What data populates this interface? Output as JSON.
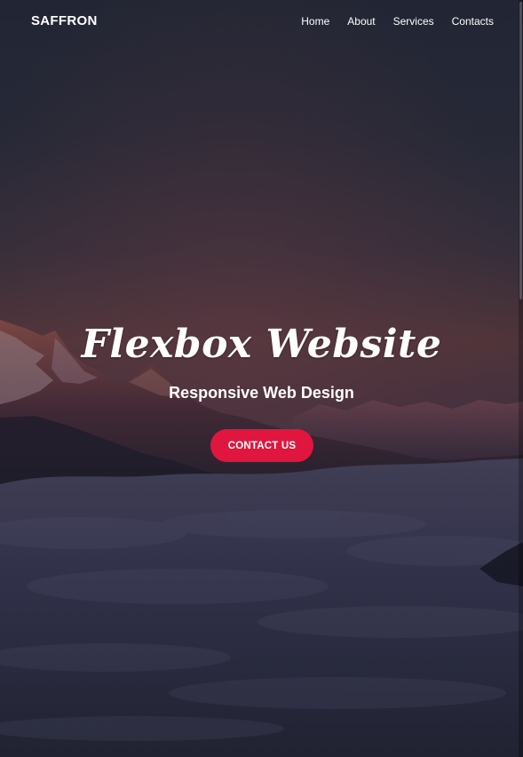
{
  "brand": {
    "name": "SAFFRON"
  },
  "nav": {
    "links": [
      {
        "label": "Home"
      },
      {
        "label": "About"
      },
      {
        "label": "Services"
      },
      {
        "label": "Contacts"
      }
    ]
  },
  "hero": {
    "title": "Flexbox Website",
    "subtitle": "Responsive Web Design",
    "cta_label": "CONTACT US",
    "background": "mountain-clouds-sunset"
  },
  "colors": {
    "accent": "#e0163f",
    "text": "#ffffff",
    "sky_top": "#2b3040",
    "sky_glow": "#5a3a3e",
    "clouds": "#2a2b40"
  }
}
